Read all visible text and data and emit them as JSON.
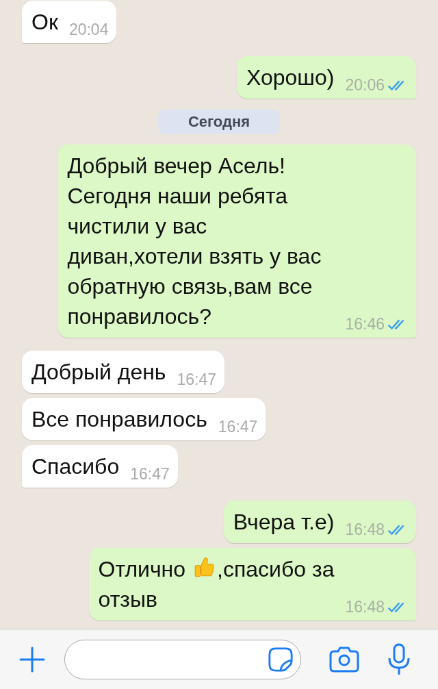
{
  "messages": [
    {
      "kind": "in",
      "text": "Ок",
      "time": "20:04"
    },
    {
      "kind": "out",
      "text": "Хорошо)",
      "time": "20:06",
      "read": true
    },
    {
      "kind": "date",
      "text": "Сегодня"
    },
    {
      "kind": "out",
      "text": "Добрый вечер Асель! Сегодня наши ребята чистили у вас диван,хотели взять у вас обратную связь,вам все понравилось?",
      "time": "16:46",
      "read": true
    },
    {
      "kind": "in",
      "text": "Добрый день",
      "time": "16:47"
    },
    {
      "kind": "in",
      "text": "Все понравилось",
      "time": "16:47"
    },
    {
      "kind": "in",
      "text": "Спасибо",
      "time": "16:47"
    },
    {
      "kind": "out",
      "text": "Вчера т.е)",
      "time": "16:48",
      "read": true
    },
    {
      "kind": "out",
      "lines": [
        [
          {
            "kind": "text",
            "text": "Отлично"
          },
          {
            "kind": "emoji"
          },
          {
            "kind": "text",
            "text": ",спасибо за"
          }
        ],
        [
          {
            "kind": "text",
            "text": "отзыв"
          }
        ]
      ],
      "time": "16:48",
      "read": true
    }
  ]
}
